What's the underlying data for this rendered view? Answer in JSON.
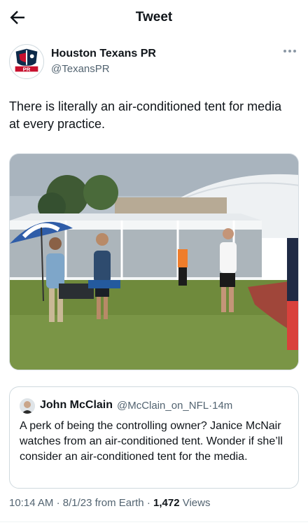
{
  "header": {
    "title": "Tweet"
  },
  "author": {
    "name": "Houston Texans PR",
    "handle": "@TexansPR",
    "avatar_badge": "PR",
    "icon": "houston-texans-logo"
  },
  "tweet": {
    "text": "There is literally an air-conditioned tent for media at every practice."
  },
  "quoted_tweet": {
    "name": "John McClain",
    "handle": "@McClain_on_NFL",
    "separator": "·",
    "age": "14m",
    "text": "A perk of being the controlling owner? Janice McNair watches from an air-conditioned tent. Wonder if she’ll consider an air-conditioned tent for the media."
  },
  "meta": {
    "time": "10:14 AM",
    "date": "8/1/23",
    "source": "from Earth",
    "views_count": "1,472",
    "views_label": "Views"
  },
  "colors": {
    "text": "#0f1419",
    "secondary": "#536471",
    "border": "#cfd9de",
    "texans_navy": "#0d2a4a",
    "texans_red": "#c8102e"
  }
}
